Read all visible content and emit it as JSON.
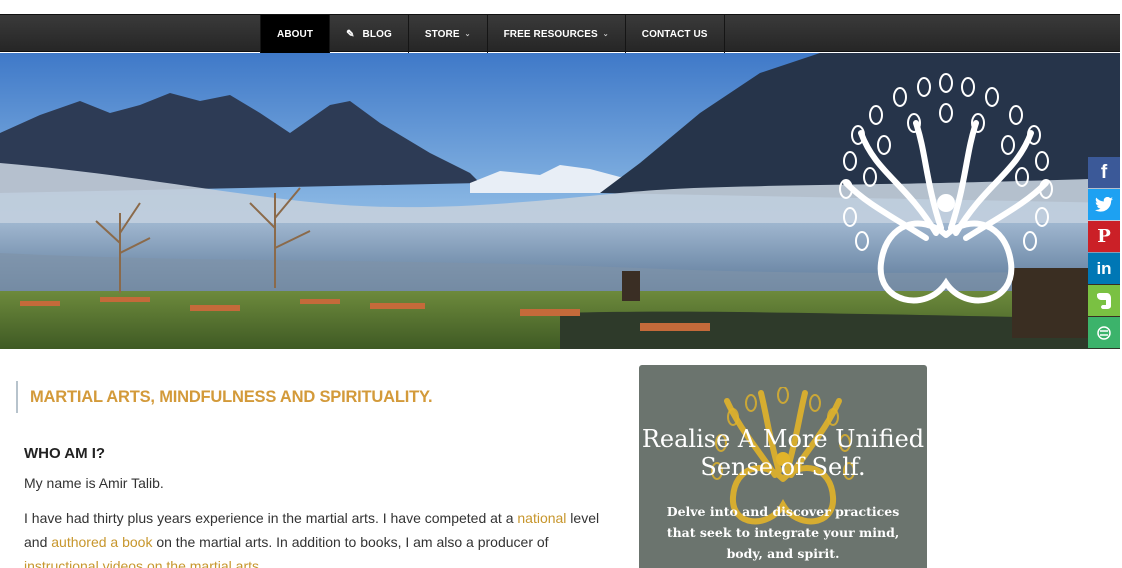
{
  "nav": {
    "items": [
      {
        "label": "ABOUT"
      },
      {
        "label": "BLOG"
      },
      {
        "label": "STORE"
      },
      {
        "label": "FREE RESOURCES"
      },
      {
        "label": "CONTACT US"
      }
    ]
  },
  "share": {
    "facebook": "f",
    "twitter": "twitter-icon",
    "pinterest": "P",
    "linkedin": "in",
    "evernote": "evernote-icon",
    "more": "share-more-icon"
  },
  "content": {
    "title": "MARTIAL ARTS, MINDFULNESS AND SPIRITUALITY.",
    "heading": "WHO AM I?",
    "intro": "My name is Amir Talib.",
    "para": {
      "t1": "I have had thirty plus years experience in the martial arts. I have competed at a ",
      "link1": "national",
      "t2": " level and ",
      "link2": "authored a book",
      "t3": " on the martial arts. In addition to books, I am also a producer of ",
      "link3": "instructional videos on the martial arts",
      "t4": "."
    }
  },
  "widget": {
    "headline": "Realise A More Unified Sense of Self.",
    "body": "Delve into and discover practices that seek to integrate your mind, body, and spirit."
  },
  "colors": {
    "accent": "#d39a3a",
    "link": "#c7962c",
    "widget_bg": "#6b746e"
  }
}
